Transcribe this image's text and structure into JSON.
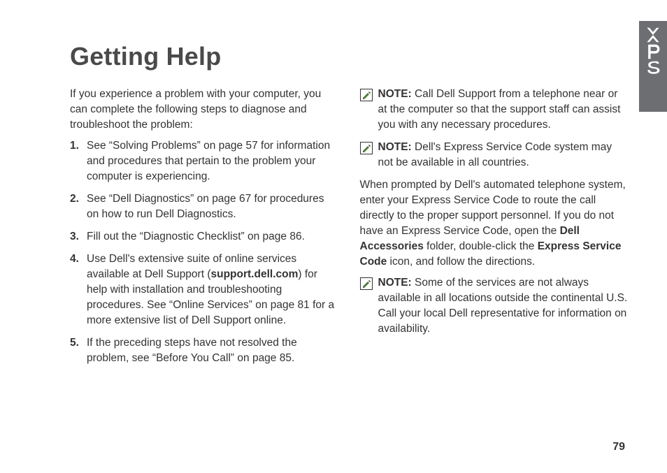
{
  "brand_tab": "xps",
  "title": "Getting Help",
  "col1": {
    "intro": "If you experience a problem with your computer, you can complete the following steps to diagnose and troubleshoot the problem:",
    "steps": [
      "See “Solving Problems” on page 57 for information and procedures that pertain to the problem your computer is experiencing.",
      "See “Dell Diagnostics” on page 67 for procedures on how to run Dell Diagnostics.",
      "Fill out the “Diagnostic Checklist” on page 86.",
      "",
      "If the preceding steps have not resolved the problem, see “Before You Call” on page 85."
    ],
    "step4_pre": "Use Dell's extensive suite of online services available at Dell Support (",
    "step4_bold": "support.dell.com",
    "step4_post": ") for help with installation and troubleshooting procedures. See “Online Services” on page 81 for a more extensive list of Dell Support online."
  },
  "col2": {
    "note_label": "NOTE:",
    "note1": " Call Dell Support from a telephone near or at the computer so that the support staff can assist you with any necessary procedures.",
    "note2": " Dell's Express Service Code system may not be available in all countries.",
    "para_pre": "When prompted by Dell's automated telephone system, enter your Express Service Code to route the call directly to the proper support personnel. If you do not have an Express Service Code, open the ",
    "para_b1": "Dell Accessories",
    "para_mid": " folder, double-click the ",
    "para_b2": "Express Service Code",
    "para_post": " icon, and follow the directions.",
    "note3": " Some of the services are not always available in all locations outside the continental U.S. Call your local Dell representative for information on availability."
  },
  "page_number": "79"
}
